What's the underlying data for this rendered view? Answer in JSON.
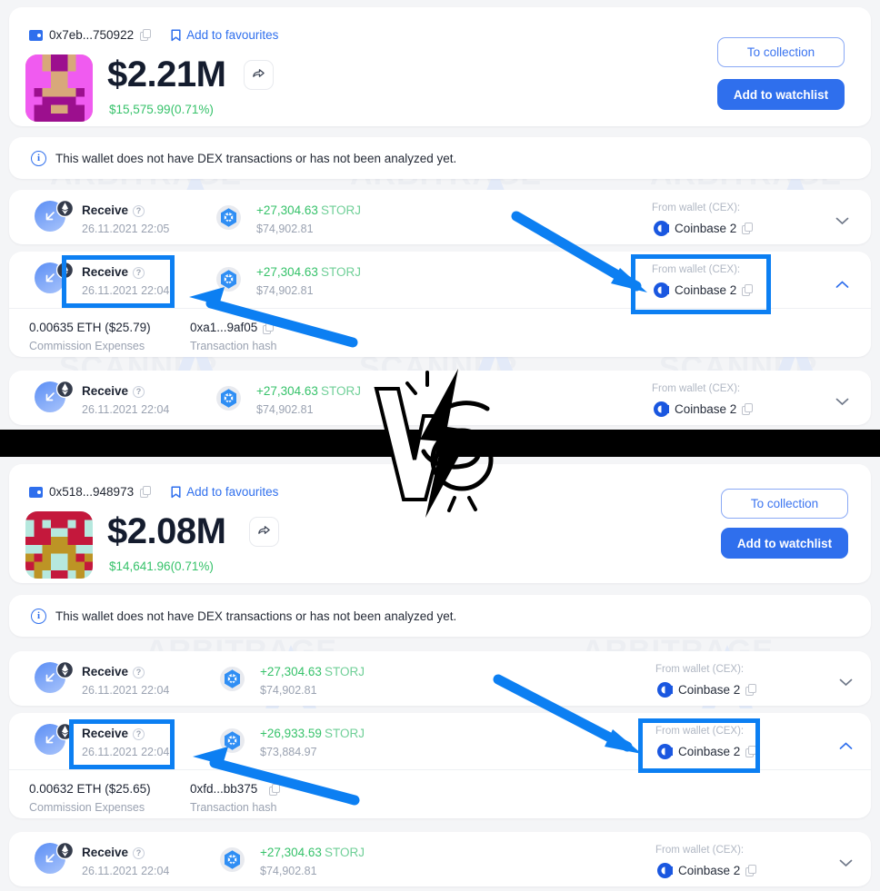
{
  "watermark": {
    "line1": "ARBITRAGE",
    "line2": "SCANNER"
  },
  "panels": [
    {
      "id": "panel-top",
      "header": {
        "address": "0x7eb...750922",
        "copy_icon": "copy-icon",
        "favourite_label": "Add to favourites",
        "favourite_icon": "bookmark-icon",
        "portfolio_value": "$2.21M",
        "share_icon": "share-icon",
        "delta": "$15,575.99(0.71%)",
        "delta_color": "#36c26a",
        "to_collection_label": "To collection",
        "add_watchlist_label": "Add to watchlist"
      },
      "notice": {
        "icon": "info-icon",
        "text": "This wallet does not have DEX transactions or has not been analyzed yet."
      },
      "transactions": [
        {
          "type": "Receive",
          "help_icon": "question-icon",
          "date": "26.11.2021 22:05",
          "token_icon": "storj-icon",
          "amount": "+27,304.63",
          "symbol": "STORJ",
          "amount_usd": "$74,902.81",
          "from_label": "From wallet (CEX):",
          "from_icon": "coinbase-icon",
          "from_name": "Coinbase 2",
          "copy_icon": "copy-icon",
          "chevron": "chevron-down-icon",
          "expanded": false,
          "highlighted": false
        },
        {
          "type": "Receive",
          "help_icon": "question-icon",
          "date": "26.11.2021 22:04",
          "token_icon": "storj-icon",
          "amount": "+27,304.63",
          "symbol": "STORJ",
          "amount_usd": "$74,902.81",
          "from_label": "From wallet (CEX):",
          "from_icon": "coinbase-icon",
          "from_name": "Coinbase 2",
          "copy_icon": "copy-icon",
          "chevron": "chevron-up-icon",
          "expanded": true,
          "highlighted": true,
          "details": {
            "commission_value": "0.00635 ETH ($25.79)",
            "commission_label": "Commission Expenses",
            "hash_value": "0xa1...9af05",
            "hash_copy_icon": "copy-icon",
            "hash_label": "Transaction hash"
          }
        },
        {
          "type": "Receive",
          "help_icon": "question-icon",
          "date": "26.11.2021 22:04",
          "token_icon": "storj-icon",
          "amount": "+27,304.63",
          "symbol": "STORJ",
          "amount_usd": "$74,902.81",
          "from_label": "From wallet (CEX):",
          "from_icon": "coinbase-icon",
          "from_name": "Coinbase 2",
          "copy_icon": "copy-icon",
          "chevron": "chevron-down-icon",
          "expanded": false,
          "highlighted": false
        }
      ]
    },
    {
      "id": "panel-bottom",
      "header": {
        "address": "0x518...948973",
        "copy_icon": "copy-icon",
        "favourite_label": "Add to favourites",
        "favourite_icon": "bookmark-icon",
        "portfolio_value": "$2.08M",
        "share_icon": "share-icon",
        "delta": "$14,641.96(0.71%)",
        "delta_color": "#36c26a",
        "to_collection_label": "To collection",
        "add_watchlist_label": "Add to watchlist"
      },
      "notice": {
        "icon": "info-icon",
        "text": "This wallet does not have DEX transactions or has not been analyzed yet."
      },
      "transactions": [
        {
          "type": "Receive",
          "help_icon": "question-icon",
          "date": "26.11.2021 22:04",
          "token_icon": "storj-icon",
          "amount": "+27,304.63",
          "symbol": "STORJ",
          "amount_usd": "$74,902.81",
          "from_label": "From wallet (CEX):",
          "from_icon": "coinbase-icon",
          "from_name": "Coinbase 2",
          "copy_icon": "copy-icon",
          "chevron": "chevron-down-icon",
          "expanded": false,
          "highlighted": false
        },
        {
          "type": "Receive",
          "help_icon": "question-icon",
          "date": "26.11.2021 22:04",
          "token_icon": "storj-icon",
          "amount": "+26,933.59",
          "symbol": "STORJ",
          "amount_usd": "$73,884.97",
          "from_label": "From wallet (CEX):",
          "from_icon": "coinbase-icon",
          "from_name": "Coinbase 2",
          "copy_icon": "copy-icon",
          "chevron": "chevron-up-icon",
          "expanded": true,
          "highlighted": true,
          "details": {
            "commission_value": "0.00632 ETH ($25.65)",
            "commission_label": "Commission Expenses",
            "hash_value": "0xfd...bb375",
            "hash_copy_icon": "copy-icon",
            "hash_label": "Transaction hash"
          }
        },
        {
          "type": "Receive",
          "help_icon": "question-icon",
          "date": "26.11.2021 22:04",
          "token_icon": "storj-icon",
          "amount": "+27,304.63",
          "symbol": "STORJ",
          "amount_usd": "$74,902.81",
          "from_label": "From wallet (CEX):",
          "from_icon": "coinbase-icon",
          "from_name": "Coinbase 2",
          "copy_icon": "copy-icon",
          "chevron": "chevron-down-icon",
          "expanded": false,
          "highlighted": false
        }
      ]
    }
  ],
  "annotations": {
    "highlight_color": "#0c7ff2",
    "arrow_color": "#0c7ff2",
    "divider_color": "#000000",
    "logo": "vs-lightning-logo"
  },
  "colors": {
    "accent": "#2f6fed",
    "positive": "#36c26a",
    "muted": "#9aa2b1",
    "background": "#f4f5f7",
    "card": "#ffffff"
  }
}
